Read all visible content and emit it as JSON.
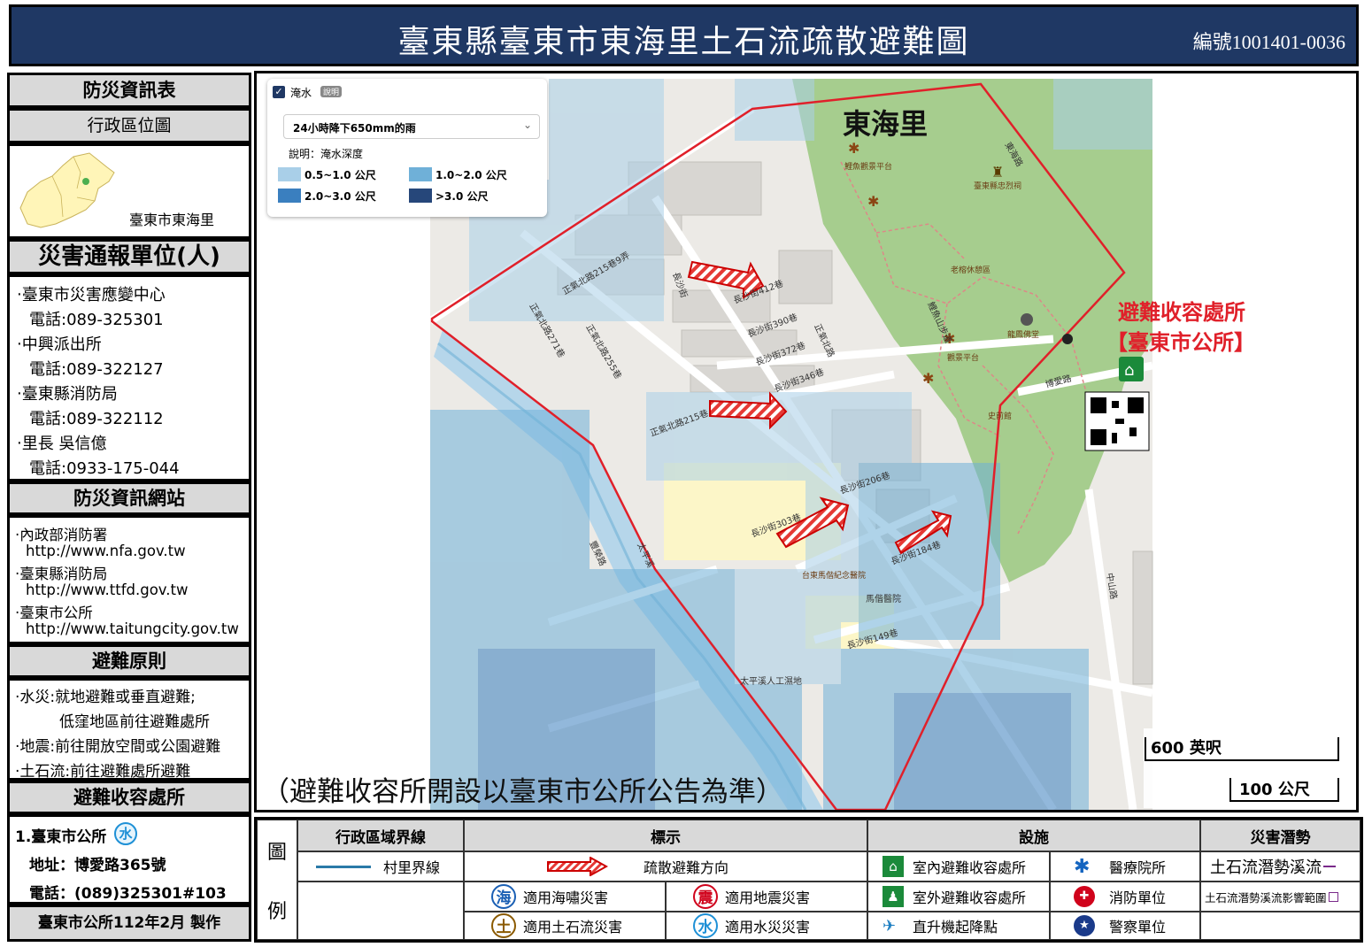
{
  "header": {
    "title": "臺東縣臺東市東海里土石流疏散避難圖",
    "map_id": "編號1001401-0036"
  },
  "left": {
    "info_table": "防災資訊表",
    "admin_map": "行政區位圖",
    "admin_caption": "臺東市東海里",
    "report_title": "災害通報單位(人)",
    "contacts": [
      "‧臺東市災害應變中心",
      "電話:089-325301",
      "‧中興派出所",
      "電話:089-322127",
      "‧臺東縣消防局",
      "電話:089-322112",
      "‧里長 吳信億",
      "電話:0933-175-044"
    ],
    "web_title": "防災資訊網站",
    "websites": [
      "‧內政部消防署",
      "http://www.nfa.gov.tw",
      "‧臺東縣消防局",
      "http://www.ttfd.gov.tw",
      "‧臺東市公所",
      "http://www.taitungcity.gov.tw"
    ],
    "principle_title": "避難原則",
    "principles": [
      "‧水災:就地避難或垂直避難;",
      "低窪地區前往避難處所",
      "‧地震:前往開放空間或公園避難",
      "‧土石流:前往避難處所避難"
    ],
    "shelter_title": "避難收容處所",
    "shelter_name": "1.臺東市公所",
    "shelter_icon": "水",
    "shelter_address": "地址：博愛路365號",
    "shelter_phone": "電話：(089)325301#103",
    "made_by": "臺東市公所112年2月 製作"
  },
  "map": {
    "village_name": "東海里",
    "shelter_label_1": "避難收容處所",
    "shelter_label_2": "【臺東市公所】",
    "notice": "（避難收容所開設以臺東市公所公告為準）",
    "flood_panel": {
      "checkbox_label": "淹水",
      "info_badge": "說明",
      "scenario": "24小時降下650mm的雨",
      "legend_title": "說明：淹水深度",
      "ranges": [
        {
          "label": "0.5~1.0 公尺",
          "color": "#a9cfe8"
        },
        {
          "label": "1.0~2.0 公尺",
          "color": "#6fb0d8"
        },
        {
          "label": "2.0~3.0 公尺",
          "color": "#3a7fbf"
        },
        {
          "label": ">3.0 公尺",
          "color": "#26477a"
        }
      ]
    },
    "scale_ft": "600 英呎",
    "scale_m": "100 公尺",
    "streets": [
      "長沙街412巷",
      "長沙街390巷",
      "長沙街372巷",
      "長沙街346巷",
      "長沙街206巷",
      "長沙街303巷",
      "長沙街184巷",
      "長沙街149巷",
      "長沙街",
      "正氣北路215巷9弄",
      "正氣北路271巷",
      "正氣北路255巷",
      "正氣北路215巷",
      "正氣北路",
      "太平溪",
      "豐榮路",
      "鯉魚山步道",
      "博愛路",
      "馬偕醫院",
      "太平溪人工濕地",
      "中山路",
      "東海路"
    ],
    "pois": [
      "鯉魚觀景平台",
      "臺東縣忠烈祠",
      "龍鳳佛堂",
      "觀景平台",
      "老榕休憩區",
      "史前館",
      "台東馬偕紀念醫院"
    ]
  },
  "legend": {
    "side_title_1": "圖",
    "side_title_2": "例",
    "col_boundary": "行政區域界線",
    "col_marks": "標示",
    "col_facilities": "設施",
    "col_hazard": "災害潛勢",
    "village_boundary": "村里界線",
    "evac_direction": "疏散避難方向",
    "tsunami": "適用海嘯災害",
    "earthquake": "適用地震災害",
    "debris": "適用土石流災害",
    "flood": "適用水災災害",
    "indoor_shelter": "室內避難收容處所",
    "outdoor_shelter": "室外避難收容處所",
    "heliport": "直升機起降點",
    "hospital": "醫療院所",
    "fire": "消防單位",
    "police": "警察單位",
    "debris_stream": "土石流潛勢溪流",
    "debris_area": "土石流潛勢溪流影響範圍",
    "icon_tsunami": "海",
    "icon_quake": "震",
    "icon_debris": "土",
    "icon_flood": "水",
    "colors": {
      "tsunami": "#1a5fb4",
      "earthquake": "#d0021b",
      "debris": "#8b5a00",
      "flood": "#1e90d6"
    }
  }
}
